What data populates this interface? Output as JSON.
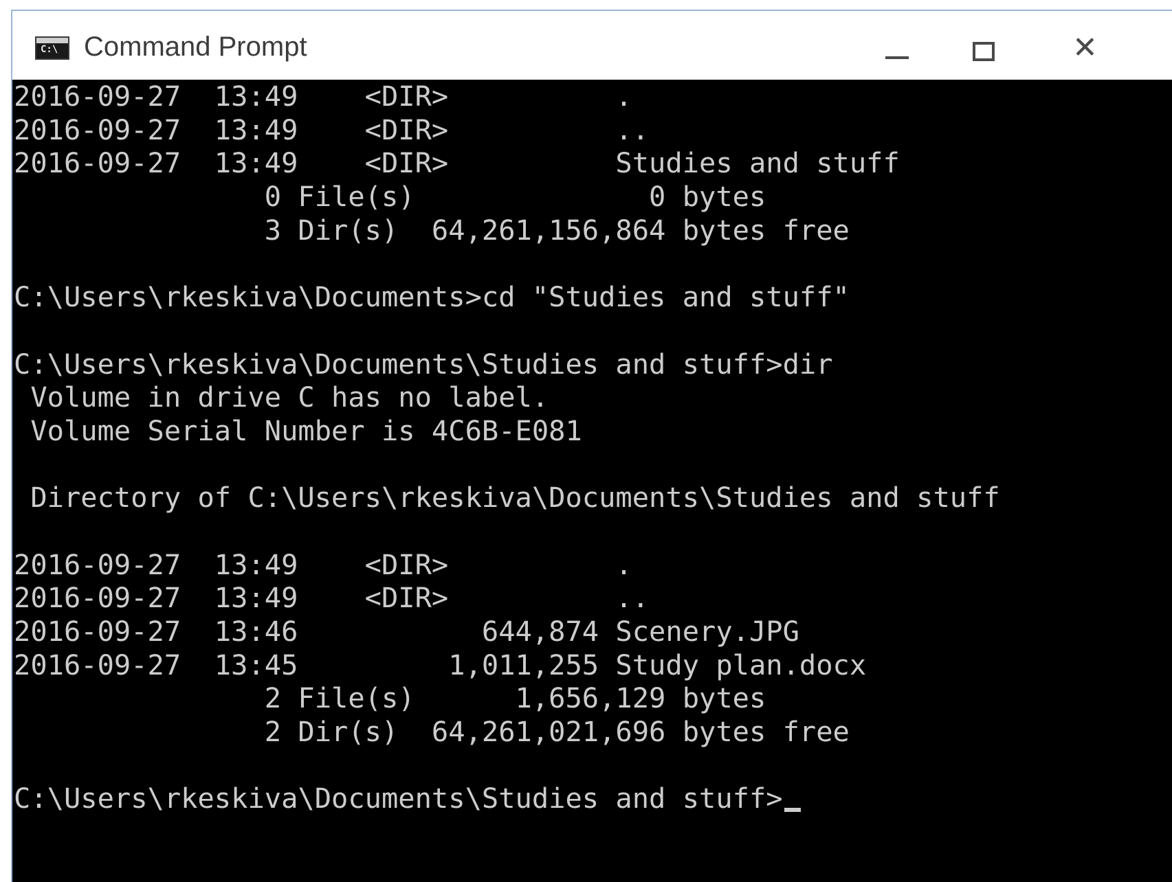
{
  "window": {
    "title": "Command Prompt",
    "icon": "cmd-icon",
    "icon_glyph": "C:\\",
    "controls": {
      "minimize": "minimize-icon",
      "maximize": "maximize-icon",
      "close": "close-icon",
      "close_glyph": "✕"
    }
  },
  "colors": {
    "console_bg": "#000000",
    "console_text": "#cccccc",
    "titlebar_bg": "#ffffff"
  },
  "console": {
    "lines": [
      "2016-09-27  13:49    <DIR>          .",
      "2016-09-27  13:49    <DIR>          ..",
      "2016-09-27  13:49    <DIR>          Studies and stuff",
      "               0 File(s)              0 bytes",
      "               3 Dir(s)  64,261,156,864 bytes free",
      "",
      "C:\\Users\\rkeskiva\\Documents>cd \"Studies and stuff\"",
      "",
      "C:\\Users\\rkeskiva\\Documents\\Studies and stuff>dir",
      " Volume in drive C has no label.",
      " Volume Serial Number is 4C6B-E081",
      "",
      " Directory of C:\\Users\\rkeskiva\\Documents\\Studies and stuff",
      "",
      "2016-09-27  13:49    <DIR>          .",
      "2016-09-27  13:49    <DIR>          ..",
      "2016-09-27  13:46           644,874 Scenery.JPG",
      "2016-09-27  13:45         1,011,255 Study plan.docx",
      "               2 File(s)      1,656,129 bytes",
      "               2 Dir(s)  64,261,021,696 bytes free",
      ""
    ],
    "prompt": "C:\\Users\\rkeskiva\\Documents\\Studies and stuff>"
  }
}
